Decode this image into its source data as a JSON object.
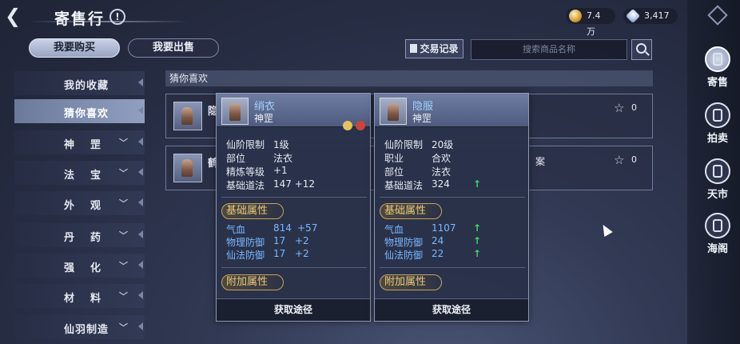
{
  "header": {
    "title": "寄售行",
    "help_glyph": "!",
    "back_glyph": "❮",
    "currency_gold": "7.4万",
    "currency_gem": "3,417"
  },
  "tabs": {
    "buy": "我要购买",
    "sell": "我要出售"
  },
  "toolbar": {
    "trade_log": "交易记录",
    "search_placeholder": "搜索商品名称"
  },
  "categories": [
    {
      "label": "我的收藏"
    },
    {
      "label": "猜你喜欢"
    },
    {
      "label": "神罡"
    },
    {
      "label": "法宝"
    },
    {
      "label": "外观"
    },
    {
      "label": "丹药"
    },
    {
      "label": "强化"
    },
    {
      "label": "材料"
    },
    {
      "label": "仙羽制造"
    }
  ],
  "main": {
    "section_title": "猜你喜欢",
    "items": [
      {
        "name_fragment": "隐",
        "favorites": "0",
        "tail": ""
      },
      {
        "name_fragment": "鹤",
        "favorites": "0",
        "tail": "案"
      }
    ]
  },
  "tooltip_left": {
    "name": "绡衣",
    "type": "神罡",
    "badge_a": "",
    "badge_b": "",
    "rows": [
      {
        "k": "仙阶限制",
        "v": "1级"
      },
      {
        "k": "部位",
        "v": "法衣"
      },
      {
        "k": "精炼等级",
        "v": "+1"
      },
      {
        "k": "基础道法",
        "v": "147 +12"
      }
    ],
    "base_title": "基础属性",
    "base_rows": [
      {
        "k": "气血",
        "v": "814",
        "v2": "+57"
      },
      {
        "k": "物理防御",
        "v": "17",
        "v2": "+2"
      },
      {
        "k": "仙法防御",
        "v": "17",
        "v2": "+2"
      }
    ],
    "extra_title": "附加属性",
    "button": "获取途径"
  },
  "tooltip_right": {
    "name": "隐服",
    "type": "神罡",
    "rows": [
      {
        "k": "仙阶限制",
        "v": "20级"
      },
      {
        "k": "职业",
        "v": "合欢"
      },
      {
        "k": "部位",
        "v": "法衣"
      },
      {
        "k": "基础道法",
        "v": "324",
        "up": "↑"
      }
    ],
    "base_title": "基础属性",
    "base_rows": [
      {
        "k": "气血",
        "v": "1107",
        "up": "↑"
      },
      {
        "k": "物理防御",
        "v": "24",
        "up": "↑"
      },
      {
        "k": "仙法防御",
        "v": "22",
        "up": "↑"
      }
    ],
    "extra_title": "附加属性",
    "button": "获取途径"
  },
  "sidebar": {
    "items": [
      {
        "label": "寄售"
      },
      {
        "label": "拍卖"
      },
      {
        "label": "天市"
      },
      {
        "label": "海阁"
      }
    ]
  },
  "colors": {
    "stat_blue": "#79b8ff",
    "up_green": "#42d36a",
    "section_gold": "#e9c979",
    "name_blue": "#9fd3ff"
  }
}
